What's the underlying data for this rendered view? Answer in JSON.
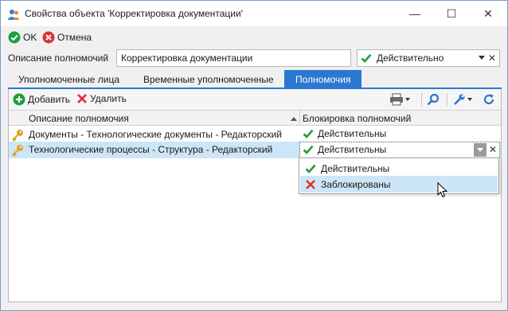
{
  "window": {
    "title": "Свойства объекта 'Корректировка документации'",
    "minimize": "—",
    "maximize": "☐",
    "close": "✕"
  },
  "toolbar": {
    "ok_label": "OK",
    "cancel_label": "Отмена"
  },
  "form": {
    "description_label": "Описание полномочий",
    "description_value": "Корректировка документации",
    "status_value": "Действительно",
    "status_clear": "✕"
  },
  "tabs": [
    {
      "label": "Уполномоченные лица"
    },
    {
      "label": "Временные уполномоченные"
    },
    {
      "label": "Полномочия",
      "active": true
    }
  ],
  "panel_toolbar": {
    "add_label": "Добавить",
    "delete_label": "Удалить"
  },
  "grid": {
    "columns": [
      "Описание полномочия",
      "Блокировка полномочий"
    ],
    "rows": [
      {
        "description": "Документы - Технологические документы - Редакторский",
        "status": "Действительны"
      },
      {
        "description": "Технологические процессы - Структура - Редакторский",
        "status": "Действительны",
        "selected": true
      }
    ]
  },
  "editor": {
    "value": "Действительны",
    "clear": "✕"
  },
  "dropdown": {
    "options": [
      "Действительны",
      "Заблокированы"
    ],
    "highlighted": 1
  },
  "colors": {
    "accent": "#2b78d1",
    "selection": "#cde6f7",
    "valid_green": "#1e9e3c",
    "blocked_red": "#e03030",
    "key_gold": "#e0a020"
  }
}
